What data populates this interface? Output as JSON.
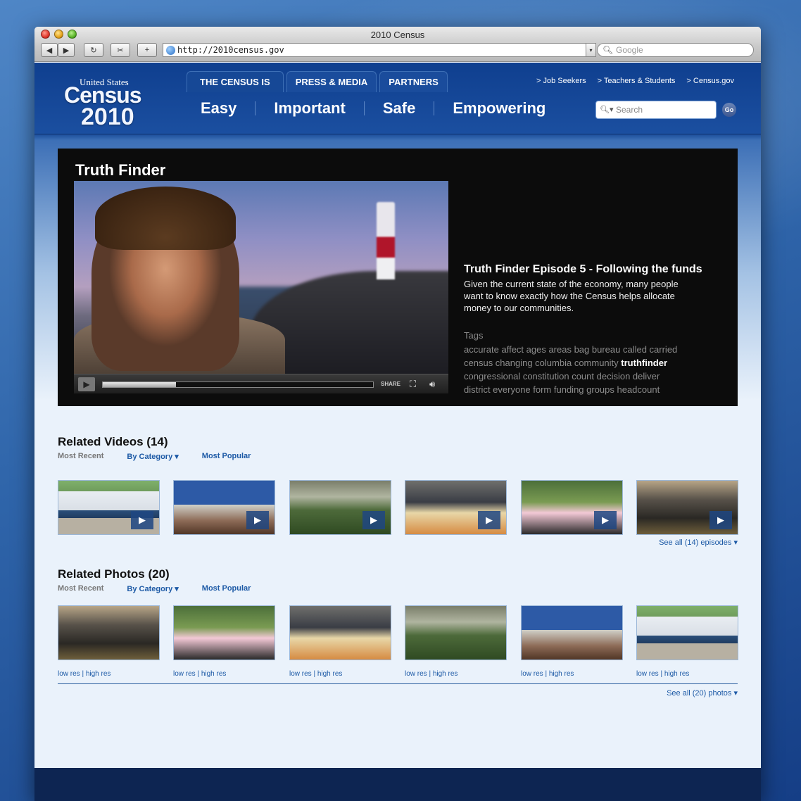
{
  "browser": {
    "window_title": "2010 Census",
    "address": "http://2010census.gov",
    "search_placeholder": "Google",
    "back": "◀",
    "forward": "▶",
    "reload": "↻",
    "snap": "✂",
    "add": "+"
  },
  "header": {
    "logo": {
      "top": "United States",
      "main": "Census",
      "year": "2010"
    },
    "tabs": [
      "THE CENSUS IS",
      "PRESS & MEDIA",
      "PARTNERS"
    ],
    "utility_links": [
      "> Job Seekers",
      "> Teachers & Students",
      "> Census.gov"
    ],
    "subnav": [
      "Easy",
      "Important",
      "Safe",
      "Empowering"
    ],
    "search_placeholder": "Search",
    "go_label": "Go"
  },
  "feature": {
    "title": "Truth Finder",
    "episode_title": "Truth Finder Episode 5 - Following the funds",
    "description": "Given the current state of the economy, many people want to know exactly how the Census helps allocate money to our communities.",
    "player": {
      "share_label": "SHARE",
      "progress": 0.27
    },
    "tags_heading": "Tags",
    "tags_line1": "accurate affect ages areas bag bureau called carried",
    "tags_line2_pre": "census changing columbia community",
    "tags_line2_hl": "truthfinder",
    "tags_line3": "congressional constitution count decision deliver",
    "tags_line4": "district everyone form funding groups headcount"
  },
  "related_videos": {
    "title": "Related Videos (14)",
    "filters": {
      "recent": "Most Recent",
      "category": "By Category ▾",
      "popular": "Most Popular"
    },
    "see_all": "See all (14) episodes  ▾"
  },
  "related_photos": {
    "title": "Related Photos (20)",
    "filters": {
      "recent": "Most Recent",
      "category": "By Category ▾",
      "popular": "Most Popular"
    },
    "links": "low res  |  high res",
    "see_all": "See all (20) photos  ▾"
  },
  "colors": {
    "brand_blue": "#1d4f9c",
    "link_blue": "#1d5aa6",
    "feature_bg": "#0c0c0c"
  }
}
